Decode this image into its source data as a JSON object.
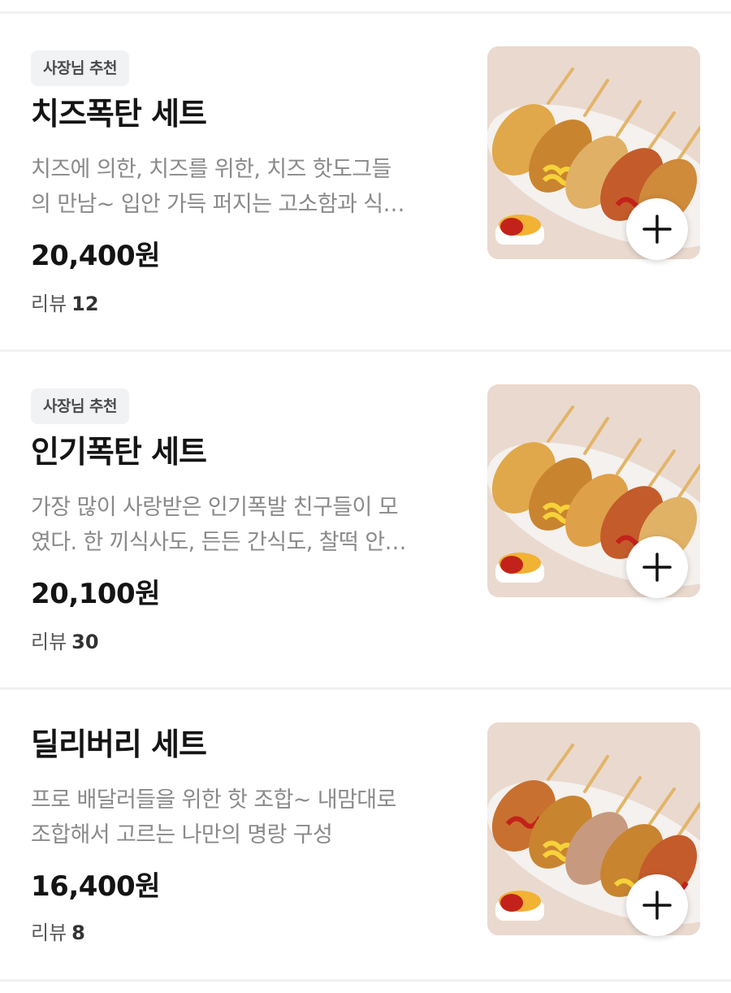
{
  "items": [
    {
      "badge": "사장님 추천",
      "name": "치즈폭탄 세트",
      "desc_line1": "치즈에 의한, 치즈를 위한, 치즈 핫도그들",
      "desc_line2": "의 만남~ 입안 가득 퍼지는 고소함과 식…",
      "price": "20,400원",
      "review_label": "리뷰",
      "review_count": "12",
      "image_icon": "corndog-platter-image",
      "add_icon": "plus-icon"
    },
    {
      "badge": "사장님 추천",
      "name": "인기폭탄 세트",
      "desc_line1": "가장 많이 사랑받은 인기폭발 친구들이 모",
      "desc_line2": "였다. 한 끼식사도, 든든 간식도, 찰떡 안…",
      "price": "20,100원",
      "review_label": "리뷰",
      "review_count": "30",
      "image_icon": "corndog-platter-image",
      "add_icon": "plus-icon"
    },
    {
      "name": "딜리버리 세트",
      "desc_line1": "프로 배달러들을 위한 핫 조합~ 내맘대로",
      "desc_line2": "조합해서 고르는 나만의 명랑 구성",
      "price": "16,400원",
      "review_label": "리뷰",
      "review_count": "8",
      "image_icon": "corndog-platter-image",
      "add_icon": "plus-icon"
    }
  ],
  "colors": {
    "badge_bg": "#f1f2f4",
    "desc_text": "#8a8a8a",
    "image_bg": "#ead9cf",
    "divider": "#f1f1f3"
  }
}
